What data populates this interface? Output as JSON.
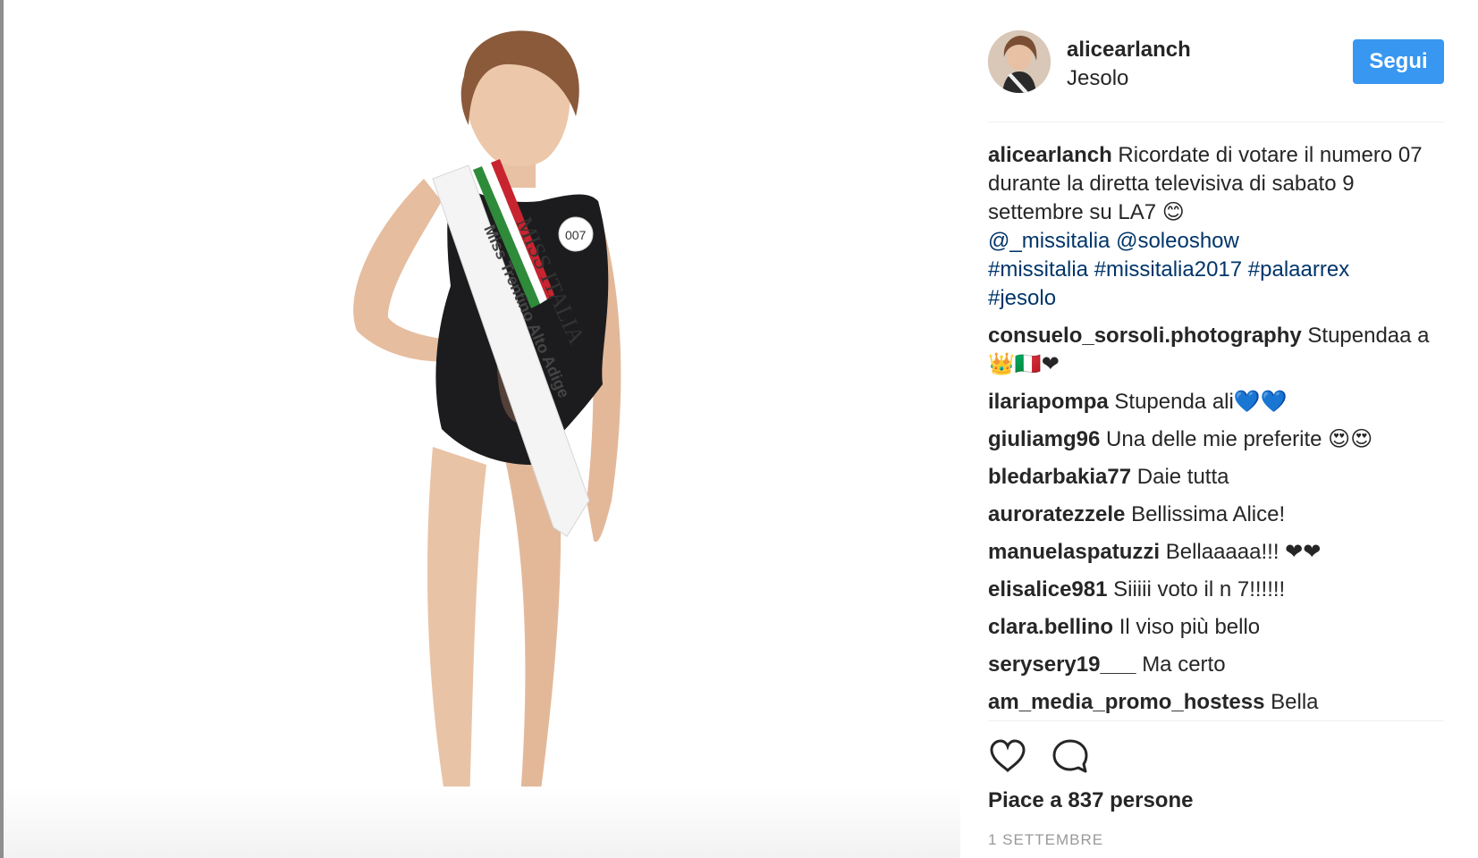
{
  "post": {
    "username": "alicearlanch",
    "location": "Jesolo",
    "follow_label": "Segui",
    "sash_text_1": "MISS ITALIA",
    "sash_text_2": "Miss Trentino Alto Adige",
    "badge_number": "007"
  },
  "caption": {
    "username": "alicearlanch",
    "text": "Ricordate di votare il numero 07 durante la diretta televisiva di sabato 9 settembre su LA7 😊",
    "mentions": [
      "@_missitalia",
      "@soleoshow"
    ],
    "hashtags": [
      "#missitalia",
      "#missitalia2017",
      "#palaarrex",
      "#jesolo"
    ]
  },
  "comments": [
    {
      "user": "consuelo_sorsoli.photography",
      "text": "Stupendaa a👑🇮🇹❤"
    },
    {
      "user": "ilariapompa",
      "text": "Stupenda ali💙💙"
    },
    {
      "user": "giuliamg96",
      "text": "Una delle mie preferite 😍😍"
    },
    {
      "user": "bledarbakia77",
      "text": "Daie tutta"
    },
    {
      "user": "auroratezzele",
      "text": "Bellissima Alice!"
    },
    {
      "user": "manuelaspatuzzi",
      "text": "Bellaaaaa!!! ❤❤"
    },
    {
      "user": "elisalice981",
      "text": "Siiiii voto il n 7!!!!!!"
    },
    {
      "user": "clara.bellino",
      "text": "Il viso più bello"
    },
    {
      "user": "serysery19___",
      "text": "Ma certo"
    },
    {
      "user": "am_media_promo_hostess",
      "text": "Bella"
    }
  ],
  "likes_label": "Piace a 837 persone",
  "date_label": "1 SETTEMBRE",
  "icons": {
    "like": "heart-icon",
    "comment": "comment-bubble-icon"
  },
  "colors": {
    "follow_button": "#3897f0",
    "link": "#003569",
    "muted": "#999999"
  }
}
